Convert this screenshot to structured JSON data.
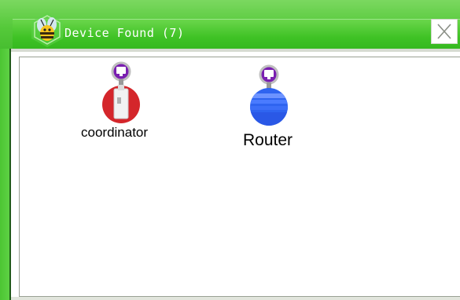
{
  "window": {
    "title": "Device Found (7)",
    "close_glyph": "✕"
  },
  "devices": [
    {
      "label": "coordinator",
      "icon": "coordinator-node-icon",
      "color": "#d4262b"
    },
    {
      "label": "Router",
      "icon": "router-node-icon",
      "color": "#2f64f0"
    }
  ],
  "colors": {
    "titlebar": "#3fb82a",
    "accent_purple": "#8a2bbd"
  }
}
